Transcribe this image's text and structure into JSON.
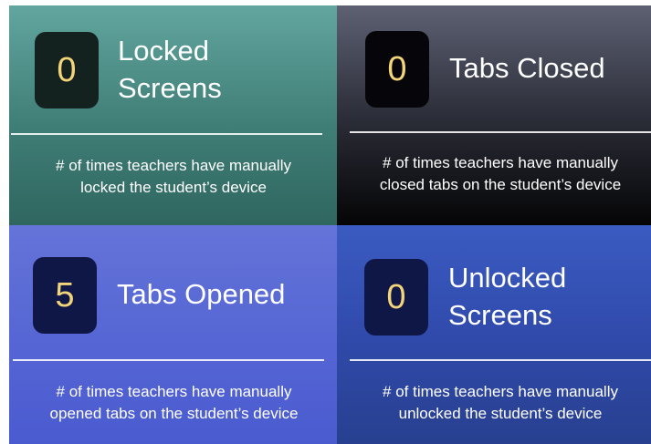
{
  "cards": [
    {
      "value": "0",
      "title_line1": "Locked",
      "title_line2": "Screens",
      "desc_line1": "# of times teachers have manually",
      "desc_line2": "locked the student’s device"
    },
    {
      "value": "0",
      "title_line1": "Tabs Closed",
      "desc_line1": "# of times teachers have manually",
      "desc_line2": "closed tabs on the student’s device"
    },
    {
      "value": "5",
      "title_line1": "Tabs Opened",
      "desc_line1": "# of times teachers have manually",
      "desc_line2": "opened tabs on the student’s device"
    },
    {
      "value": "0",
      "title_line1": "Unlocked",
      "title_line2": "Screens",
      "desc_line1": "# of times teachers have manually",
      "desc_line2": "unlocked the student’s device"
    }
  ],
  "colors": {
    "badge_number": "#f2d47a",
    "text": "#ffffff"
  }
}
